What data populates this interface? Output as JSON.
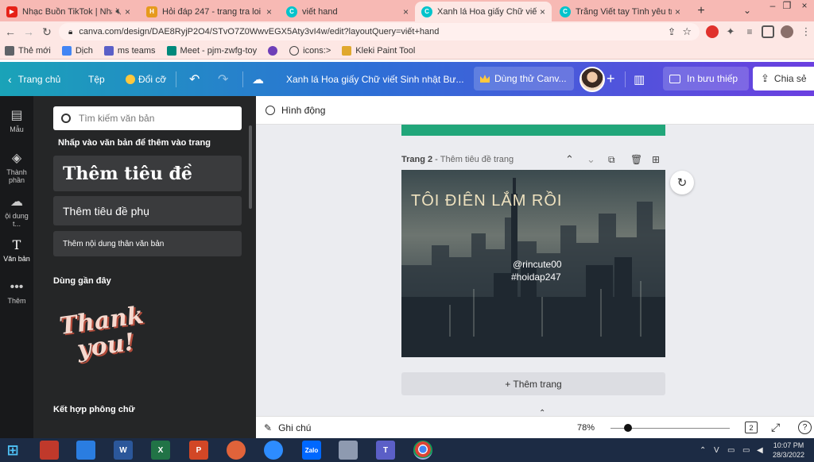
{
  "browser": {
    "tabs": [
      {
        "title": "Nhạc Buồn TikTok | Nhạc T",
        "favicon_color": "#e62117",
        "active": false
      },
      {
        "title": "Hỏi đáp 247 - trang tra loi",
        "favicon_color": "#e69a1c",
        "active": false
      },
      {
        "title": "viết hand",
        "favicon_color": "#00c4cc",
        "active": false
      },
      {
        "title": "Xanh lá Hoa giấy Chữ viết Sinh",
        "favicon_color": "#00c4cc",
        "active": true
      },
      {
        "title": "Trắng Viết tay Tình yêu trên N",
        "favicon_color": "#00c4cc",
        "active": false
      }
    ],
    "url": "canva.com/design/DAE8RyjP2O4/STvO7Z0WwvEGX5Aty3vI4w/edit?layoutQuery=viết+hand",
    "bookmarks": [
      {
        "label": "Thẻ mới",
        "color": "#5f6368"
      },
      {
        "label": "Dịch",
        "color": "#4285f4"
      },
      {
        "label": "ms teams",
        "color": "#5b5fc7"
      },
      {
        "label": "Meet - pjm-zwfg-toy",
        "color": "#00897b"
      },
      {
        "label": "",
        "color": "#6e3fb8"
      },
      {
        "label": "icons:>",
        "color": "#444444"
      },
      {
        "label": "Kleki Paint Tool",
        "color": "#e0a82e"
      }
    ]
  },
  "canva_bar": {
    "home": "Trang chủ",
    "file": "Tệp",
    "resize": "Đổi cỡ",
    "design_title": "Xanh lá Hoa giấy Chữ viết Sinh nhật Bư...",
    "try_pro": "Dùng thử Canv...",
    "print": "In bưu thiếp",
    "share": "Chia sẻ"
  },
  "rail": [
    {
      "label": "Mẫu",
      "icon": "template-icon"
    },
    {
      "label": "Thành phần",
      "icon": "elements-icon"
    },
    {
      "label": "ội dung t...",
      "icon": "upload-icon"
    },
    {
      "label": "Văn bản",
      "icon": "text-icon"
    },
    {
      "label": "Thêm",
      "icon": "more-icon"
    }
  ],
  "panel": {
    "search_placeholder": "Tìm kiếm văn bản",
    "instruction": "Nhấp vào văn bản để thêm vào trang",
    "heading": "Thêm tiêu đề",
    "subheading": "Thêm tiêu đề phụ",
    "body": "Thêm nội dung thân văn bản",
    "recent_label": "Dùng gần đây",
    "sample_line1": "Thank",
    "sample_line2": "you!",
    "font_combo_label": "Kết hợp phông chữ"
  },
  "editor": {
    "animate": "Hình động",
    "page_label": "Trang 2",
    "page_title_placeholder": "Thêm tiêu đề trang",
    "page_text_title": "TÔI ĐIÊN LẮM RỒI",
    "page_text_handle": "@rincute00",
    "page_text_tag": "#hoidap247",
    "add_page": "+ Thêm trang",
    "notes": "Ghi chú",
    "zoom": "78%",
    "zoom_level": 0.12,
    "page_count": "2"
  },
  "taskbar": {
    "apps": [
      {
        "name": "start",
        "color": "#1aa1e6",
        "label": ""
      },
      {
        "name": "app",
        "color": "#c0392b",
        "label": ""
      },
      {
        "name": "explorer",
        "color": "#2a7de1",
        "label": ""
      },
      {
        "name": "word",
        "color": "#2b579a",
        "label": "W"
      },
      {
        "name": "excel",
        "color": "#217346",
        "label": "X"
      },
      {
        "name": "powerpoint",
        "color": "#d24726",
        "label": "P"
      },
      {
        "name": "app2",
        "color": "#e0633a",
        "label": ""
      },
      {
        "name": "zoom",
        "color": "#2d8cff",
        "label": ""
      },
      {
        "name": "zalo",
        "color": "#0068ff",
        "label": "Zalo"
      },
      {
        "name": "app3",
        "color": "#8e9ab0",
        "label": ""
      },
      {
        "name": "teams",
        "color": "#5b5fc7",
        "label": "T"
      },
      {
        "name": "chrome",
        "color": "#db4437",
        "label": ""
      }
    ],
    "lang": "V",
    "time": "10:07 PM",
    "date": "28/3/2022"
  }
}
